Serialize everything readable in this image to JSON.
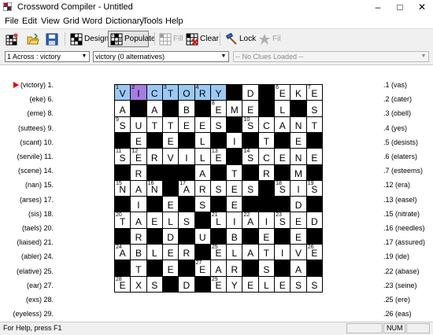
{
  "window": {
    "title": "Crossword Compiler - Untitled",
    "controls": {
      "minimize": "–",
      "maximize": "□",
      "close": "✕"
    }
  },
  "menu": [
    "File",
    "Edit",
    "View",
    "Grid",
    "Word",
    "Dictionary",
    "Tools",
    "Help"
  ],
  "toolbar": {
    "design": "Design",
    "populate": "Populate",
    "fill_disabled": "Fill",
    "clear": "Clear",
    "lock": "Lock",
    "fill2_disabled": "Fil"
  },
  "selector": {
    "word": "1 Across : victory",
    "alternatives": "victory (0 alternatives)",
    "clues": "-- No Clues Loaded --"
  },
  "colors": {
    "selected_word": "#9cc8f4",
    "cursor_cell": "#a67be2",
    "marker": "#e00000"
  },
  "across_clues": [
    "(victory) 1.",
    "(eke) 6.",
    "(eme) 8.",
    "(suttees) 9.",
    "(scant) 10.",
    "(servile) 11.",
    "(scene) 14.",
    "(nan) 15.",
    "(arses) 17.",
    "(sis) 18.",
    "(taels) 20.",
    "(liaised) 21.",
    "(abler) 24.",
    "(elative) 25.",
    "(ear) 27.",
    "(exs) 28.",
    "(eyeless) 29."
  ],
  "down_clues": [
    ".1 (vas)",
    ".2 (cater)",
    ".3 (obell)",
    ".4 (yes)",
    ".5 (desists)",
    ".6 (elaters)",
    ".7 (esteems)",
    ".12 (era)",
    ".13 (easel)",
    ".15 (nitrate)",
    ".16 (needles)",
    ".17 (assured)",
    ".19 (ide)",
    ".22 (abase)",
    ".23 (seine)",
    ".25 (ere)",
    ".26 (eas)"
  ],
  "grid": {
    "size": 13,
    "rows": [
      "VICTORY#D#EKE",
      "A#A#B#EME#L#S",
      "SUTTEES#SCANT",
      "#E#E#L#I#T#E#",
      "SERVILE#SCENE",
      "#R###A#T#R#M#",
      "NAN#ARSES#SIS",
      "#I#E#S#E###D#",
      "TAELS#LIAISED",
      "#R#D#U#B#E#E#",
      "ABLER#ELATIVE",
      "#T#E#EAR#S#A#",
      "EXS#D#EYELESS"
    ],
    "numbers": [
      [
        0,
        0,
        "1"
      ],
      [
        0,
        1,
        "2"
      ],
      [
        0,
        3,
        "3"
      ],
      [
        0,
        5,
        "4"
      ],
      [
        0,
        7,
        "5"
      ],
      [
        0,
        10,
        "6"
      ],
      [
        0,
        12,
        "7"
      ],
      [
        1,
        6,
        "8"
      ],
      [
        2,
        0,
        "9"
      ],
      [
        2,
        8,
        "10"
      ],
      [
        4,
        0,
        "11"
      ],
      [
        4,
        1,
        "12"
      ],
      [
        4,
        6,
        "13"
      ],
      [
        4,
        8,
        "14"
      ],
      [
        6,
        0,
        "15"
      ],
      [
        6,
        2,
        "16"
      ],
      [
        6,
        4,
        "17"
      ],
      [
        6,
        10,
        "18"
      ],
      [
        6,
        12,
        "19"
      ],
      [
        8,
        0,
        "20"
      ],
      [
        8,
        6,
        "21"
      ],
      [
        8,
        8,
        "22"
      ],
      [
        8,
        10,
        "23"
      ],
      [
        10,
        0,
        "24"
      ],
      [
        10,
        6,
        "25"
      ],
      [
        10,
        12,
        "26"
      ],
      [
        11,
        5,
        "27"
      ],
      [
        12,
        0,
        "28"
      ],
      [
        12,
        6,
        "29"
      ]
    ],
    "selected": [
      [
        0,
        0
      ],
      [
        0,
        1
      ],
      [
        0,
        2
      ],
      [
        0,
        3
      ],
      [
        0,
        4
      ],
      [
        0,
        5
      ],
      [
        0,
        6
      ]
    ],
    "cursor": [
      0,
      1
    ]
  },
  "status": {
    "help": "For Help, press F1",
    "num": "NUM"
  }
}
